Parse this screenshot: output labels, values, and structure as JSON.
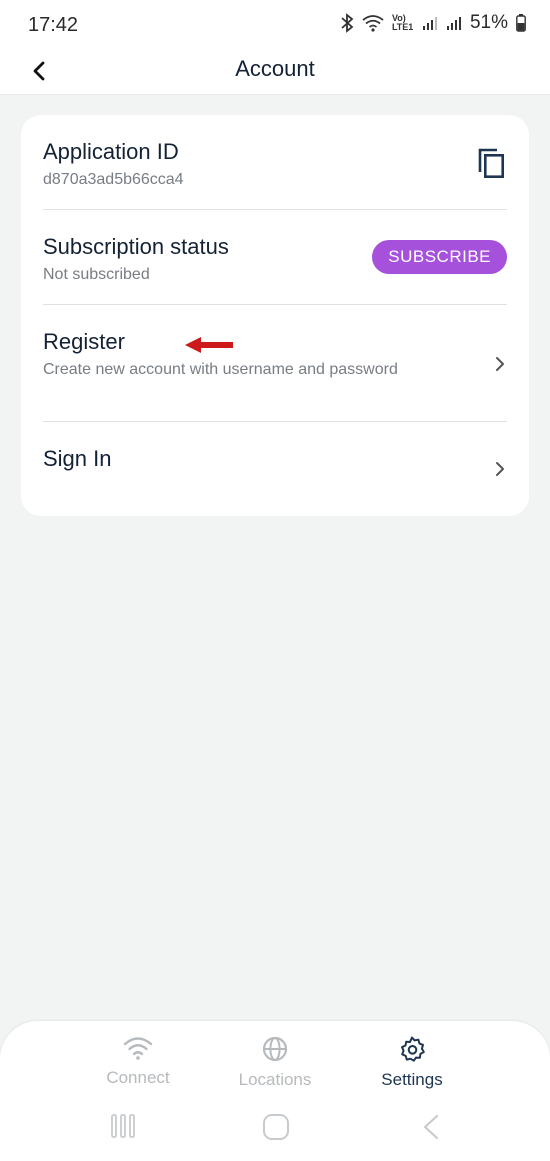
{
  "status_bar": {
    "time": "17:42",
    "network_label": "Vo) LTE1",
    "battery": "51%"
  },
  "header": {
    "title": "Account",
    "back_icon": "chevron-left-icon"
  },
  "account": {
    "application_id": {
      "title": "Application ID",
      "value": "d870a3ad5b66cca4",
      "icon": "copy-icon"
    },
    "subscription": {
      "title": "Subscription status",
      "value": "Not subscribed",
      "button_label": "SUBSCRIBE"
    },
    "register": {
      "title": "Register",
      "description": "Create new account with username and password"
    },
    "sign_in": {
      "title": "Sign In"
    }
  },
  "bottom_nav": {
    "items": [
      {
        "label": "Connect",
        "icon": "wifi-icon",
        "active": false
      },
      {
        "label": "Locations",
        "icon": "globe-icon",
        "active": false
      },
      {
        "label": "Settings",
        "icon": "gear-icon",
        "active": true
      }
    ]
  },
  "colors": {
    "accent": "#a551dc",
    "nav_active": "#1e3552",
    "nav_inactive": "#b6babd",
    "annotation_arrow": "#cc1a1a"
  }
}
